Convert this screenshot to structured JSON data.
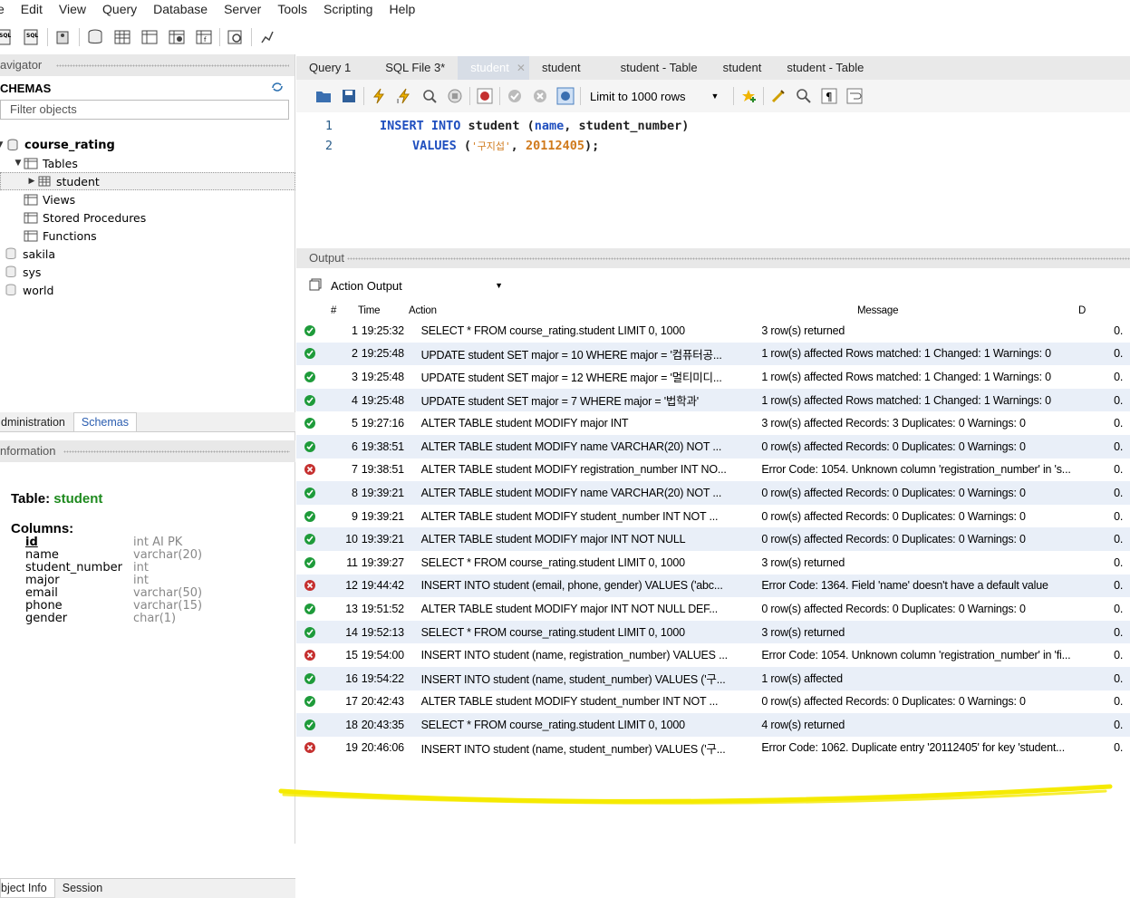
{
  "menu": [
    "e",
    "Edit",
    "View",
    "Query",
    "Database",
    "Server",
    "Tools",
    "Scripting",
    "Help"
  ],
  "navigator": {
    "header": "avigator",
    "schemas_title": "CHEMAS",
    "filter_placeholder": "Filter objects",
    "tree": [
      {
        "label": "course_rating",
        "bold": true
      },
      {
        "label": "Tables"
      },
      {
        "label": "student",
        "selected": true
      },
      {
        "label": "Views"
      },
      {
        "label": "Stored Procedures"
      },
      {
        "label": "Functions"
      },
      {
        "label": "sakila"
      },
      {
        "label": "sys"
      },
      {
        "label": "world"
      }
    ]
  },
  "left_tabs": [
    "dministration",
    "Schemas"
  ],
  "info_header": "nformation",
  "info": {
    "table_label": "Table:",
    "table_name": "student",
    "columns_label": "Columns:",
    "columns": [
      {
        "name": "id",
        "type": "int AI PK"
      },
      {
        "name": "name",
        "type": "varchar(20)"
      },
      {
        "name": "student_number",
        "type": "int"
      },
      {
        "name": "major",
        "type": "int"
      },
      {
        "name": "email",
        "type": "varchar(50)"
      },
      {
        "name": "phone",
        "type": "varchar(15)"
      },
      {
        "name": "gender",
        "type": "char(1)"
      }
    ]
  },
  "bottom_tabs": [
    "bject Info",
    "Session"
  ],
  "editor_tabs": [
    "Query 1",
    "SQL File 3*",
    "student",
    "student",
    "student - Table",
    "student",
    "student - Table"
  ],
  "sql_toolbar": {
    "limit_label": "Limit to 1000 rows"
  },
  "sql": {
    "line1_kw": "INSERT INTO",
    "line1_rest": "student (",
    "line1_col1": "name",
    "line1_rest2": ", student_number)",
    "line2_kw": "VALUES",
    "line2_open": "(",
    "line2_str": "'구지섭'",
    "line2_comma": ", ",
    "line2_num": "20112405",
    "line2_close": ");"
  },
  "output": {
    "header": "Output",
    "selector": "Action Output",
    "columns": [
      "#",
      "Time",
      "Action",
      "Message",
      "D"
    ],
    "rows": [
      {
        "n": "1",
        "time": "19:25:32",
        "action": "SELECT * FROM course_rating.student LIMIT 0, 1000",
        "msg": "3 row(s) returned",
        "status": "ok"
      },
      {
        "n": "2",
        "time": "19:25:48",
        "action": "UPDATE student SET major = 10 WHERE major = '컴퓨터공...",
        "msg": "1 row(s) affected Rows matched: 1  Changed: 1  Warnings: 0",
        "status": "ok"
      },
      {
        "n": "3",
        "time": "19:25:48",
        "action": "UPDATE student SET major = 12 WHERE major = '멀티미디...",
        "msg": "1 row(s) affected Rows matched: 1  Changed: 1  Warnings: 0",
        "status": "ok"
      },
      {
        "n": "4",
        "time": "19:25:48",
        "action": "UPDATE student SET major = 7 WHERE major = '법학과'",
        "msg": "1 row(s) affected Rows matched: 1  Changed: 1  Warnings: 0",
        "status": "ok"
      },
      {
        "n": "5",
        "time": "19:27:16",
        "action": "ALTER TABLE student MODIFY major INT",
        "msg": "3 row(s) affected Records: 3  Duplicates: 0  Warnings: 0",
        "status": "ok"
      },
      {
        "n": "6",
        "time": "19:38:51",
        "action": "ALTER TABLE student MODIFY name VARCHAR(20) NOT ...",
        "msg": "0 row(s) affected Records: 0  Duplicates: 0  Warnings: 0",
        "status": "ok"
      },
      {
        "n": "7",
        "time": "19:38:51",
        "action": "ALTER TABLE student MODIFY registration_number INT NO...",
        "msg": "Error Code: 1054. Unknown column 'registration_number' in 's...",
        "status": "err"
      },
      {
        "n": "8",
        "time": "19:39:21",
        "action": "ALTER TABLE student MODIFY name VARCHAR(20) NOT ...",
        "msg": "0 row(s) affected Records: 0  Duplicates: 0  Warnings: 0",
        "status": "ok"
      },
      {
        "n": "9",
        "time": "19:39:21",
        "action": "ALTER TABLE student MODIFY student_number INT NOT ...",
        "msg": "0 row(s) affected Records: 0  Duplicates: 0  Warnings: 0",
        "status": "ok"
      },
      {
        "n": "10",
        "time": "19:39:21",
        "action": "ALTER TABLE student MODIFY major INT NOT NULL",
        "msg": "0 row(s) affected Records: 0  Duplicates: 0  Warnings: 0",
        "status": "ok"
      },
      {
        "n": "11",
        "time": "19:39:27",
        "action": "SELECT * FROM course_rating.student LIMIT 0, 1000",
        "msg": "3 row(s) returned",
        "status": "ok"
      },
      {
        "n": "12",
        "time": "19:44:42",
        "action": "INSERT INTO student (email, phone, gender) VALUES ('abc...",
        "msg": "Error Code: 1364. Field 'name' doesn't have a default value",
        "status": "err"
      },
      {
        "n": "13",
        "time": "19:51:52",
        "action": "ALTER TABLE student MODIFY major INT NOT NULL DEF...",
        "msg": "0 row(s) affected Records: 0  Duplicates: 0  Warnings: 0",
        "status": "ok"
      },
      {
        "n": "14",
        "time": "19:52:13",
        "action": "SELECT * FROM course_rating.student LIMIT 0, 1000",
        "msg": "3 row(s) returned",
        "status": "ok"
      },
      {
        "n": "15",
        "time": "19:54:00",
        "action": "INSERT INTO student (name, registration_number) VALUES ...",
        "msg": "Error Code: 1054. Unknown column 'registration_number' in 'fi...",
        "status": "err"
      },
      {
        "n": "16",
        "time": "19:54:22",
        "action": "INSERT INTO student (name, student_number) VALUES ('구...",
        "msg": "1 row(s) affected",
        "status": "ok"
      },
      {
        "n": "17",
        "time": "20:42:43",
        "action": "ALTER TABLE student MODIFY student_number INT NOT ...",
        "msg": "0 row(s) affected Records: 0  Duplicates: 0  Warnings: 0",
        "status": "ok"
      },
      {
        "n": "18",
        "time": "20:43:35",
        "action": "SELECT * FROM course_rating.student LIMIT 0, 1000",
        "msg": "4 row(s) returned",
        "status": "ok"
      },
      {
        "n": "19",
        "time": "20:46:06",
        "action": "INSERT INTO student (name, student_number) VALUES ('구...",
        "msg": "Error Code: 1062. Duplicate entry '20112405' for key 'student...",
        "status": "err"
      }
    ],
    "duration_prefix": "0."
  },
  "colors": {
    "ok": "#1e9b3a",
    "error": "#c5302f",
    "highlight": "#f5ea00",
    "table_name": "#1e8a1e"
  }
}
